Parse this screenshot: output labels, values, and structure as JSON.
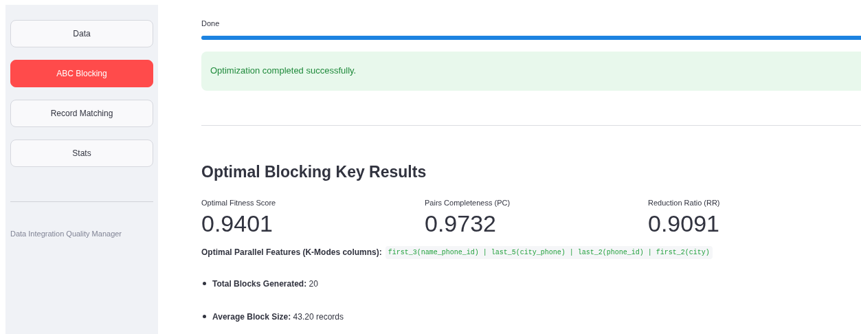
{
  "sidebar": {
    "items": [
      {
        "label": "Data",
        "selected": false
      },
      {
        "label": "ABC Blocking",
        "selected": true
      },
      {
        "label": "Record Matching",
        "selected": false
      },
      {
        "label": "Stats",
        "selected": false
      }
    ],
    "caption": "Data Integration Quality Manager"
  },
  "progress": {
    "label": "Done",
    "level": 1
  },
  "alert": {
    "kind": "success",
    "text": "Optimization completed successfully."
  },
  "results": {
    "heading": "Optimal Blocking Key Results",
    "metrics": [
      {
        "label": "Optimal Fitness Score",
        "value": "0.9401"
      },
      {
        "label": "Pairs Completeness (PC)",
        "value": "0.9732"
      },
      {
        "label": "Reduction Ratio (RR)",
        "value": "0.9091"
      }
    ],
    "features_label": "Optimal Parallel Features (K-Modes columns):",
    "features_code": "first_3(name_phone_id) | last_5(city_phone) | last_2(phone_id) | first_2(city)",
    "bullets": [
      "**Total Blocks Generated:** 20",
      "**Average Block Size:** 43.20 records"
    ]
  }
}
